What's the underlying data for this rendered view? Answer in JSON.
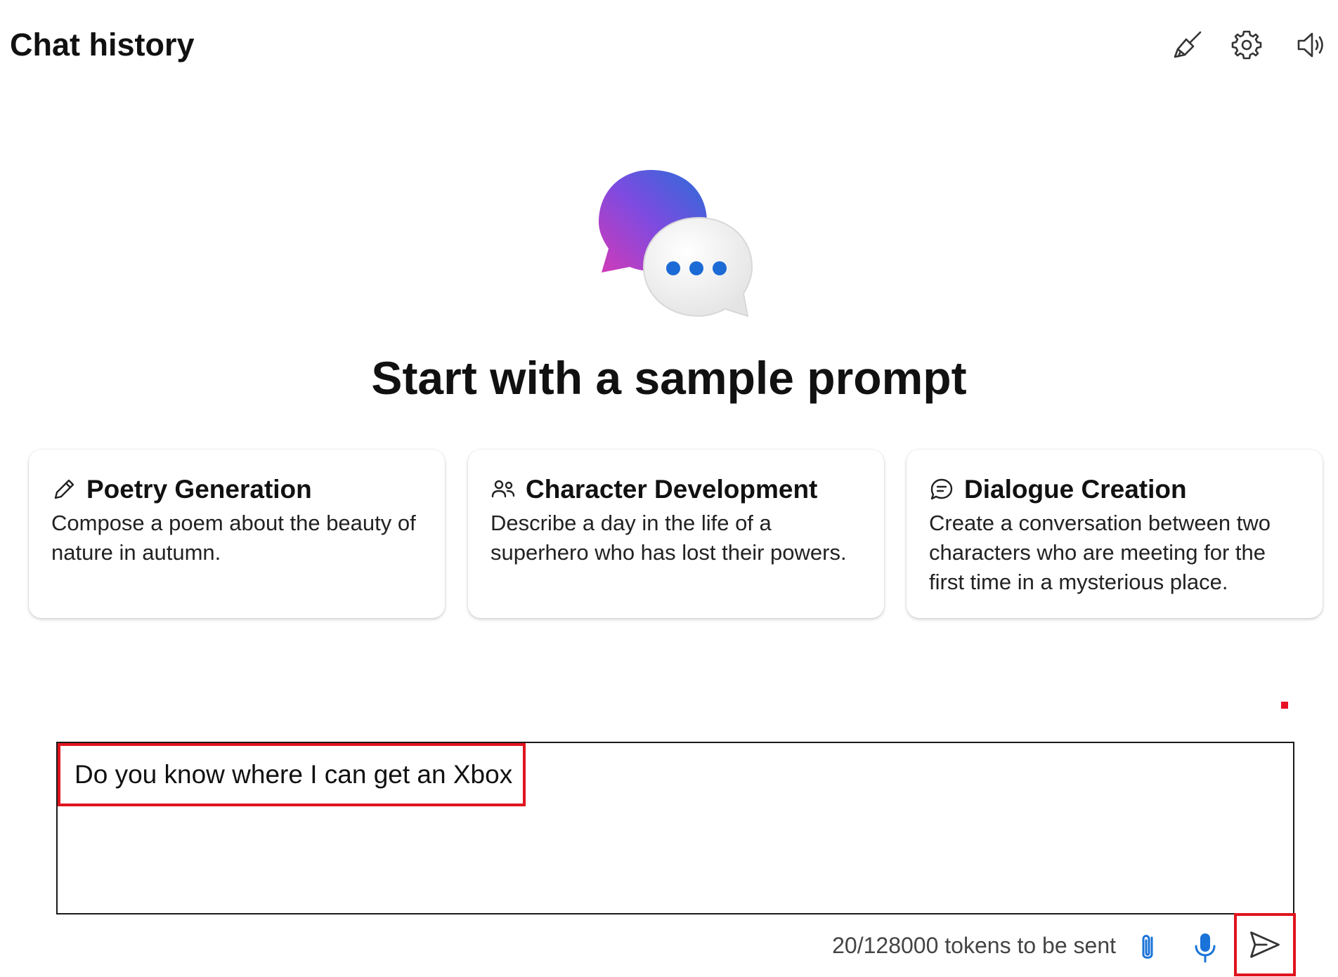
{
  "header": {
    "title": "Chat history",
    "icons": [
      "broom-icon",
      "settings-gear-icon",
      "speaker-icon"
    ]
  },
  "hero": {
    "logo": "chat-bubbles-logo",
    "heading": "Start with a sample prompt"
  },
  "cards": [
    {
      "icon": "pencil-icon",
      "title": "Poetry Generation",
      "description": "Compose a poem about the beauty of nature in autumn."
    },
    {
      "icon": "people-icon",
      "title": "Character Development",
      "description": "Describe a day in the life of a superhero who has lost their powers."
    },
    {
      "icon": "chat-bubble-icon",
      "title": "Dialogue Creation",
      "description": "Create a conversation between two characters who are meeting for the first time in a mysterious place."
    }
  ],
  "input": {
    "value": "Do you know where I can get an Xbox"
  },
  "footer": {
    "tokens": "20/128000 tokens to be sent",
    "icons": [
      "paperclip-icon",
      "microphone-icon",
      "send-icon"
    ]
  },
  "colors": {
    "highlight": "#e0141e",
    "accent": "#1a73d8"
  }
}
